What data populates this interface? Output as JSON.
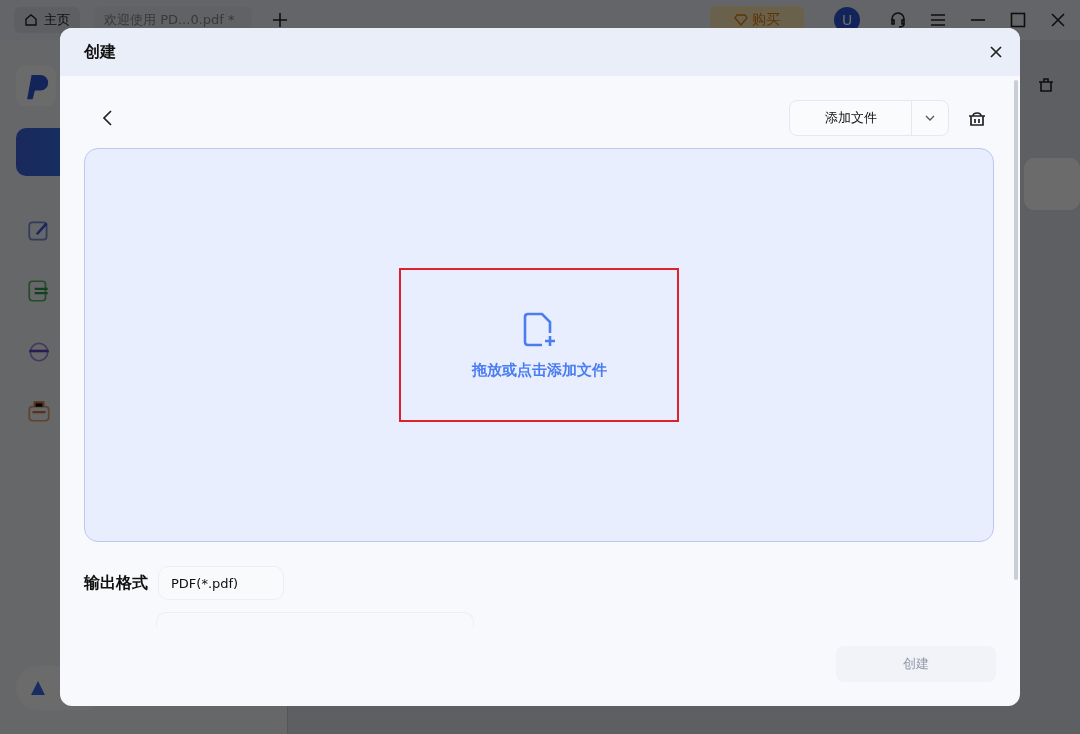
{
  "app_bar": {
    "tabs": [
      {
        "label": "主页",
        "kind": "home",
        "selected": true
      },
      {
        "label": "欢迎使用 PD...0.pdf *",
        "kind": "document",
        "selected": false
      }
    ],
    "buy_button": "购买",
    "avatar": "U"
  },
  "dialog": {
    "title": "创建",
    "add_file_button": "添加文件",
    "drop_zone": {
      "prompt": "拖放或点击添加文件",
      "highlighted": true
    },
    "output_format": {
      "label": "输出格式",
      "value": "PDF(*.pdf)"
    },
    "create_button": {
      "label": "创建",
      "disabled": true
    }
  }
}
